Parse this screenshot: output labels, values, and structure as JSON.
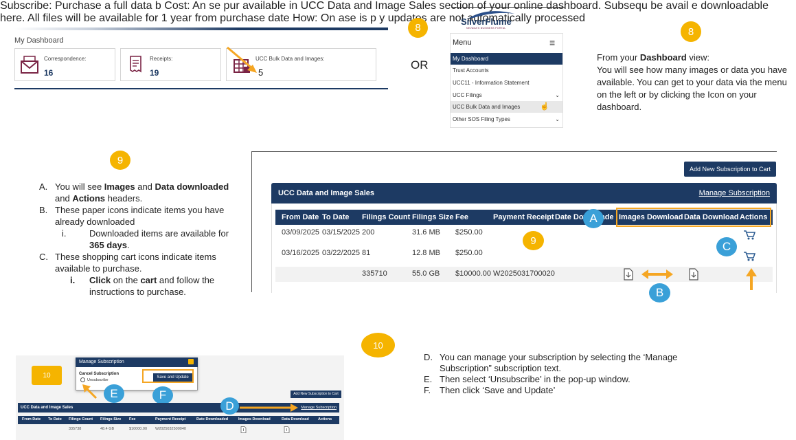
{
  "dashboard": {
    "title": "My Dashboard",
    "cards": [
      {
        "label": "Correspondence:",
        "value": "16",
        "icon": "envelope-icon"
      },
      {
        "label": "Receipts:",
        "value": "19",
        "icon": "receipt-icon"
      },
      {
        "label": "UCC Bulk Data and Images:",
        "value": "5",
        "icon": "bulk-data-icon"
      }
    ]
  },
  "or_label": "OR",
  "steps": {
    "eight": "8",
    "nine": "9",
    "ten": "10"
  },
  "menu": {
    "logo": "SilverFlume",
    "logo_sub": "NEVADA'S BUSINESS PORTAL",
    "title": "Menu",
    "items": [
      {
        "label": "My Dashboard"
      },
      {
        "label": "Trust Accounts"
      },
      {
        "label": "UCC11 - Information Statement"
      },
      {
        "label": "UCC Filings"
      },
      {
        "label": "UCC Bulk Data and Images"
      },
      {
        "label": "Other SOS Filing Types"
      }
    ]
  },
  "text8": {
    "line1_pre": "From your ",
    "line1_bold": "Dashboard",
    "line1_post": " view:",
    "body": "You will see how many images or data you have available. You can get to your data via the menu on the left or by clicking the Icon on your dashboard."
  },
  "list9": {
    "a_marker": "A.",
    "a_1": "You will see ",
    "a_images": "Images",
    "a_2": " and ",
    "a_data_downloaded": "Data downloaded",
    "a_3": "  and ",
    "a_actions": "Actions",
    "a_4": " headers.",
    "b_marker": "B.",
    "b_text": "These paper icons indicate items you have already downloaded",
    "b_i_marker": "i.",
    "b_i_1": "Downloaded items are available for ",
    "b_i_bold": "365 days",
    "b_i_2": ".",
    "c_marker": "C.",
    "c_text": "These shopping cart icons indicate items available to purchase.",
    "c_i_marker": "i.",
    "c_i_bold1": "Click",
    "c_i_1": " on the ",
    "c_i_bold2": "cart",
    "c_i_2": " and follow the instructions to purchase."
  },
  "sales": {
    "add_button": "Add New Subscription to Cart",
    "title": "UCC Data and Image Sales",
    "manage_link": "Manage Subscription",
    "headers": [
      "From Date",
      "To Date",
      "Filings Count",
      "Filings Size",
      "Fee",
      "Payment Receipt",
      "Date Downloaded",
      "Images Download",
      "Data Download",
      "Actions"
    ],
    "rows": [
      {
        "from": "03/09/2025",
        "to": "03/15/2025",
        "count": "200",
        "size": "31.6 MB",
        "fee": "$250.00",
        "receipt": ""
      },
      {
        "from": "03/16/2025",
        "to": "03/22/2025",
        "count": "81",
        "size": "12.8 MB",
        "fee": "$250.00",
        "receipt": ""
      },
      {
        "from": "",
        "to": "",
        "count": "335710",
        "size": "55.0 GB",
        "fee": "$10000.00",
        "receipt": "W2025031700020"
      }
    ],
    "callouts": {
      "a": "A",
      "b": "B",
      "c": "C"
    }
  },
  "bottom": {
    "popup_title": "Manage Subscription",
    "cancel_label": "Cancel Subscription",
    "unsubscribe": "Unsubscribe",
    "save_button": "Save and Update",
    "add_button": "Add New Subscription to Cart",
    "title": "UCC Data and Image Sales",
    "manage_link": "Manage Subscription",
    "bg_line1a": "Subscribe: Purchase a full data b",
    "bg_line2a": "Cost: An",
    "bg_line2b": "se pur",
    "bg_line2c": "available in UCC Data and Image Sales section of your online dashboard.",
    "bg_line3a": "Subsequ",
    "bg_line3b": "be avail",
    "bg_line3c": "e downloadable here. All files will be available for 1 year from purchase date",
    "bg_line4a": "How: On",
    "bg_line4b": "ase is p",
    "bg_line4c": "y updates are not automatically processed",
    "headers": [
      "From Date",
      "To Date",
      "Filings Count",
      "Filings Size",
      "Fee",
      "Payment Receipt",
      "Date Downloaded",
      "Images Download",
      "Data Download",
      "Actions"
    ],
    "row": {
      "count": "335738",
      "size": "48.4 GB",
      "fee": "$10000.00",
      "receipt": "W2025032500040"
    },
    "callouts": {
      "d": "D",
      "e": "E",
      "f": "F"
    }
  },
  "text10": {
    "d_marker": "D.",
    "d": "  You can manage your subscription by selecting the ‘Manage Subscription” subscription text.",
    "e_marker": "E.",
    "e": "Then select ‘Unsubscribe’ in the pop-up window.",
    "f_marker": "F.",
    "f": "Then click ‘Save and Update’"
  },
  "colors": {
    "navy": "#1d3a63",
    "accent": "#f5b400",
    "callout_blue": "#3aa0d8",
    "arrow": "#f5a623"
  }
}
